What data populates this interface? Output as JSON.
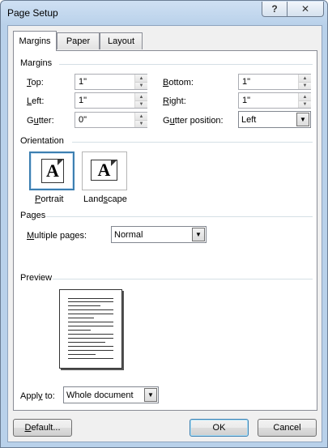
{
  "window": {
    "title": "Page Setup",
    "help_glyph": "?",
    "close_glyph": "✕"
  },
  "tabs": [
    {
      "label": "Margins",
      "active": true
    },
    {
      "label": "Paper",
      "active": false
    },
    {
      "label": "Layout",
      "active": false
    }
  ],
  "margins": {
    "heading": "Margins",
    "top": {
      "label_key": "T",
      "label_rest": "op:",
      "value": "1\""
    },
    "left": {
      "label_key": "L",
      "label_rest": "eft:",
      "value": "1\""
    },
    "gutter": {
      "label_pre": "G",
      "label_key": "u",
      "label_rest": "tter:",
      "value": "0\""
    },
    "bottom": {
      "label_key": "B",
      "label_rest": "ottom:",
      "value": "1\""
    },
    "right": {
      "label_key": "R",
      "label_rest": "ight:",
      "value": "1\""
    },
    "gutter_position": {
      "label_pre": "G",
      "label_key": "u",
      "label_rest": "tter position:",
      "value": "Left"
    }
  },
  "orientation": {
    "heading": "Orientation",
    "portrait": {
      "glyph": "A",
      "label_pre": "",
      "label_key": "P",
      "label_rest": "ortrait",
      "selected": true
    },
    "landscape": {
      "glyph": "A",
      "label_pre": "Land",
      "label_key": "s",
      "label_rest": "cape",
      "selected": false
    }
  },
  "pages": {
    "heading": "Pages",
    "multiple_pages": {
      "label_pre": "",
      "label_key": "M",
      "label_rest": "ultiple pages:",
      "value": "Normal"
    }
  },
  "preview": {
    "heading": "Preview"
  },
  "apply_to": {
    "label_pre": "Appl",
    "label_key": "y",
    "label_rest": " to:",
    "value": "Whole document"
  },
  "buttons": {
    "default": {
      "label_pre": "",
      "label_key": "D",
      "label_rest": "efault..."
    },
    "ok": "OK",
    "cancel": "Cancel"
  },
  "colors": {
    "title_gradient_top": "#cfe0f3",
    "title_gradient_bottom": "#b9d1ea",
    "focus_blue": "#3c7fb1"
  }
}
